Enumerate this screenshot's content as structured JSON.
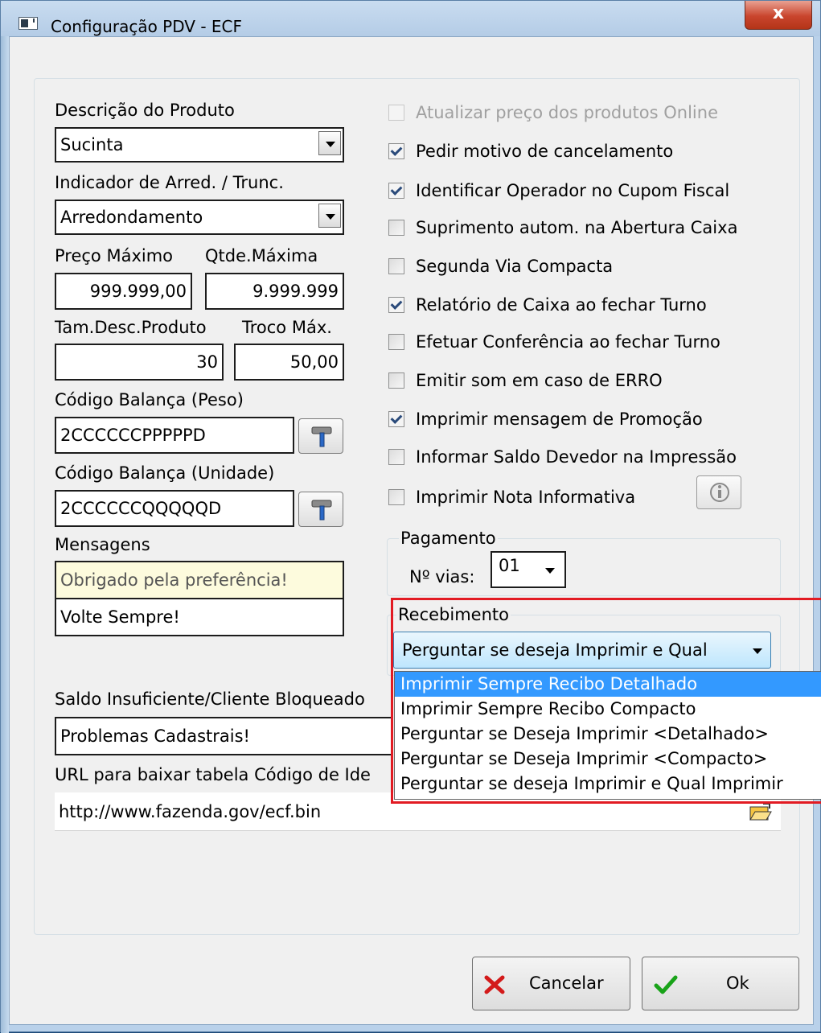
{
  "window": {
    "title": "Configuração PDV - ECF",
    "close_label": "x"
  },
  "left": {
    "descricao_label": "Descrição do Produto",
    "descricao_value": "Sucinta",
    "indicador_label": "Indicador de Arred. / Trunc.",
    "indicador_value": "Arredondamento",
    "preco_label": "Preço Máximo",
    "preco_value": "999.999,00",
    "qtde_label": "Qtde.Máxima",
    "qtde_value": "9.999.999",
    "tamdesc_label": "Tam.Desc.Produto",
    "tamdesc_value": "30",
    "troco_label": "Troco Máx.",
    "troco_value": "50,00",
    "balanca_peso_label": "Código Balança (Peso)",
    "balanca_peso_value": "2CCCCCCPPPPPD",
    "balanca_unidade_label": "Código Balança (Unidade)",
    "balanca_unidade_value": "2CCCCCCQQQQQD",
    "mensagens_label": "Mensagens",
    "mensagem1": "Obrigado pela preferência!",
    "mensagem2": "Volte Sempre!",
    "saldo_label": "Saldo Insuficiente/Cliente Bloqueado",
    "saldo_value": "Problemas Cadastrais!",
    "url_label": "URL para baixar tabela Código de Ide",
    "url_value": "http://www.fazenda.gov/ecf.bin"
  },
  "options": [
    {
      "label": "Atualizar preço dos produtos Online",
      "checked": false,
      "enabled": false
    },
    {
      "label": "Pedir motivo de cancelamento",
      "checked": true,
      "enabled": true
    },
    {
      "label": "Identificar Operador no Cupom Fiscal",
      "checked": true,
      "enabled": true
    },
    {
      "label": "Suprimento autom. na Abertura Caixa",
      "checked": false,
      "enabled": true
    },
    {
      "label": "Segunda Via Compacta",
      "checked": false,
      "enabled": true
    },
    {
      "label": "Relatório de Caixa ao fechar Turno",
      "checked": true,
      "enabled": true
    },
    {
      "label": "Efetuar Conferência ao fechar Turno",
      "checked": false,
      "enabled": true
    },
    {
      "label": "Emitir som em caso de ERRO",
      "checked": false,
      "enabled": true
    },
    {
      "label": "Imprimir mensagem de Promoção",
      "checked": true,
      "enabled": true
    },
    {
      "label": "Informar Saldo Devedor na Impressão",
      "checked": false,
      "enabled": true
    },
    {
      "label": "Imprimir Nota Informativa",
      "checked": false,
      "enabled": true
    }
  ],
  "pagamento": {
    "title": "Pagamento",
    "vias_label": "Nº vias:",
    "vias_value": "01"
  },
  "recebimento": {
    "title": "Recebimento",
    "selected": "Perguntar se deseja Imprimir e Qual",
    "options": [
      "Imprimir Sempre Recibo Detalhado",
      "Imprimir Sempre Recibo Compacto",
      "Perguntar se Deseja Imprimir <Detalhado>",
      "Perguntar se Deseja Imprimir <Compacto>",
      "Perguntar se deseja Imprimir e Qual Imprimir"
    ],
    "highlighted_index": 0
  },
  "buttons": {
    "cancel": "Cancelar",
    "ok": "Ok"
  },
  "colors": {
    "window_frame": "#b9d1ea",
    "client_bg": "#f0f0f0",
    "selection": "#3399ff",
    "annotation_red": "#e21b23",
    "message_yellow": "#fdfbdd"
  }
}
